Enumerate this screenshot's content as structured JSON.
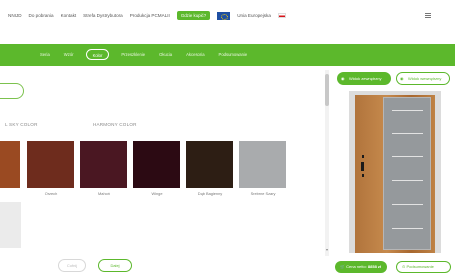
{
  "nav": {
    "links": [
      "NNIJD",
      "Do pobrania",
      "Kontakt",
      "Strefa Dystrybutora",
      "Produkcja PCMALII"
    ],
    "cta_label": "Gdzie kupić?",
    "eu_label": "Unia Europejska",
    "icons": [
      "eu-flag-icon",
      "poland-flag-icon",
      "hamburger-menu-icon"
    ]
  },
  "tabs": [
    {
      "label": "Seria",
      "active": false
    },
    {
      "label": "Wzór",
      "active": false
    },
    {
      "label": "Kolor",
      "active": true
    },
    {
      "label": "Przeszklenie",
      "active": false
    },
    {
      "label": "Okucia",
      "active": false
    },
    {
      "label": "Akcesoria",
      "active": false
    },
    {
      "label": "Podsumowanie",
      "active": false
    }
  ],
  "color_groups": [
    "L SKY COLOR",
    "HARMONY COLOR"
  ],
  "swatches": [
    {
      "label": "",
      "color": "#9a4a22"
    },
    {
      "label": "Orzech",
      "color": "#6e2c1d"
    },
    {
      "label": "Mahoń",
      "color": "#4a1722"
    },
    {
      "label": "Winge",
      "color": "#2c0a13"
    },
    {
      "label": "Dąb Bagienny",
      "color": "#2d1e14"
    },
    {
      "label": "Srebrne Szary",
      "color": "#a9abad"
    }
  ],
  "buttons": {
    "prev": "Cofnij",
    "next": "Dalej"
  },
  "view": {
    "outside": "Widok zewnętrzny",
    "inside": "Widok wewnętrzny"
  },
  "price": {
    "label": "Cena netto:",
    "value": "8858 zł"
  },
  "summary_label": "Podsumowanie",
  "accent_color": "#5cb82c"
}
